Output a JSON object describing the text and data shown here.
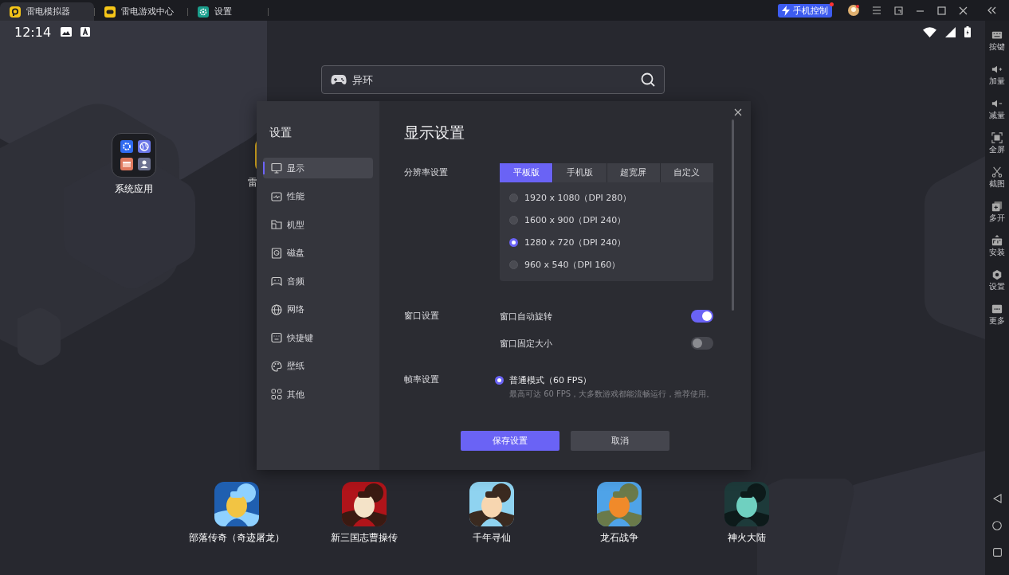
{
  "tabs": [
    {
      "label": "雷电模拟器",
      "selected": true
    },
    {
      "label": "雷电游戏中心",
      "selected": false
    },
    {
      "label": "设置",
      "selected": false
    }
  ],
  "title_bar": {
    "phone_control": "手机控制"
  },
  "status_bar": {
    "time": "12:14"
  },
  "search": {
    "placeholder": "异环"
  },
  "desktop_apps": [
    {
      "label": "系统应用"
    },
    {
      "label": "雷"
    }
  ],
  "dialog": {
    "title": "设置",
    "nav": [
      {
        "label": "显示",
        "selected": true
      },
      {
        "label": "性能",
        "selected": false
      },
      {
        "label": "机型",
        "selected": false
      },
      {
        "label": "磁盘",
        "selected": false
      },
      {
        "label": "音频",
        "selected": false
      },
      {
        "label": "网络",
        "selected": false
      },
      {
        "label": "快捷键",
        "selected": false
      },
      {
        "label": "壁纸",
        "selected": false
      },
      {
        "label": "其他",
        "selected": false
      }
    ],
    "heading": "显示设置",
    "resolution": {
      "label": "分辨率设置",
      "modes": [
        {
          "label": "平板版",
          "selected": true
        },
        {
          "label": "手机版",
          "selected": false
        },
        {
          "label": "超宽屏",
          "selected": false
        },
        {
          "label": "自定义",
          "selected": false
        }
      ],
      "options": [
        {
          "label": "1920 x 1080（DPI 280）",
          "selected": false
        },
        {
          "label": "1600 x 900（DPI 240）",
          "selected": false
        },
        {
          "label": "1280 x 720（DPI 240）",
          "selected": true
        },
        {
          "label": "960 x 540（DPI 160）",
          "selected": false
        }
      ]
    },
    "window": {
      "label": "窗口设置",
      "switches": [
        {
          "label": "窗口自动旋转",
          "on": true
        },
        {
          "label": "窗口固定大小",
          "on": false
        }
      ]
    },
    "frame_rate": {
      "label": "帧率设置",
      "options": [
        {
          "label": "普通模式（60 FPS）",
          "selected": true,
          "description": "最高可达 60 FPS，大多数游戏都能流畅运行，推荐使用。"
        }
      ]
    },
    "buttons": [
      {
        "label": "保存设置",
        "kind": "primary"
      },
      {
        "label": "取消",
        "kind": "secondary"
      }
    ]
  },
  "dock_apps": [
    {
      "label": "部落传奇（奇迹屠龙）"
    },
    {
      "label": "新三国志曹操传"
    },
    {
      "label": "千年寻仙"
    },
    {
      "label": "龙石战争"
    },
    {
      "label": "神火大陆"
    }
  ],
  "toolbar": [
    {
      "label": "按键"
    },
    {
      "label": "加量"
    },
    {
      "label": "减量"
    },
    {
      "label": "全屏"
    },
    {
      "label": "截图"
    },
    {
      "label": "多开"
    },
    {
      "label": "安装"
    },
    {
      "label": "设置"
    },
    {
      "label": "更多"
    }
  ]
}
